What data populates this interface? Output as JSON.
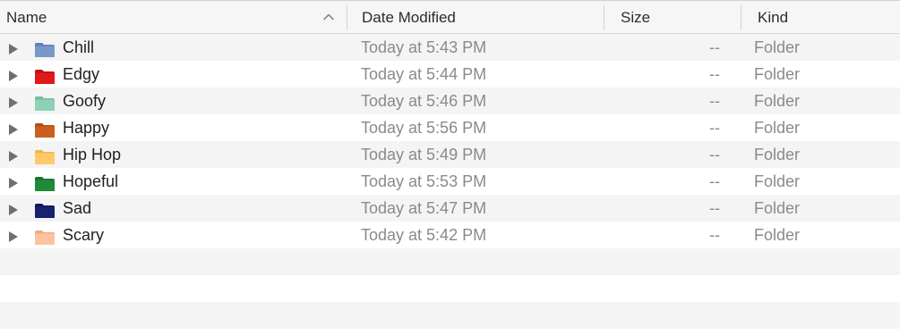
{
  "columns": {
    "name": "Name",
    "date": "Date Modified",
    "size": "Size",
    "kind": "Kind"
  },
  "sort": {
    "column": "name",
    "direction": "ascending",
    "icon": "chevron-up-icon"
  },
  "rows": [
    {
      "name": "Chill",
      "date": "Today at 5:43 PM",
      "size": "--",
      "kind": "Folder",
      "color": "#7a97c9",
      "tab": "#5f7fb5"
    },
    {
      "name": "Edgy",
      "date": "Today at 5:44 PM",
      "size": "--",
      "kind": "Folder",
      "color": "#e01a1a",
      "tab": "#c40f0f"
    },
    {
      "name": "Goofy",
      "date": "Today at 5:46 PM",
      "size": "--",
      "kind": "Folder",
      "color": "#8fd1b6",
      "tab": "#72bd9e"
    },
    {
      "name": "Happy",
      "date": "Today at 5:56 PM",
      "size": "--",
      "kind": "Folder",
      "color": "#c9601e",
      "tab": "#b04f14"
    },
    {
      "name": "Hip Hop",
      "date": "Today at 5:49 PM",
      "size": "--",
      "kind": "Folder",
      "color": "#ffc96a",
      "tab": "#f2b44a"
    },
    {
      "name": "Hopeful",
      "date": "Today at 5:53 PM",
      "size": "--",
      "kind": "Folder",
      "color": "#1f8a3a",
      "tab": "#14752d"
    },
    {
      "name": "Sad",
      "date": "Today at 5:47 PM",
      "size": "--",
      "kind": "Folder",
      "color": "#16236e",
      "tab": "#0e185a"
    },
    {
      "name": "Scary",
      "date": "Today at 5:42 PM",
      "size": "--",
      "kind": "Folder",
      "color": "#ffc2a1",
      "tab": "#f2a983"
    }
  ]
}
